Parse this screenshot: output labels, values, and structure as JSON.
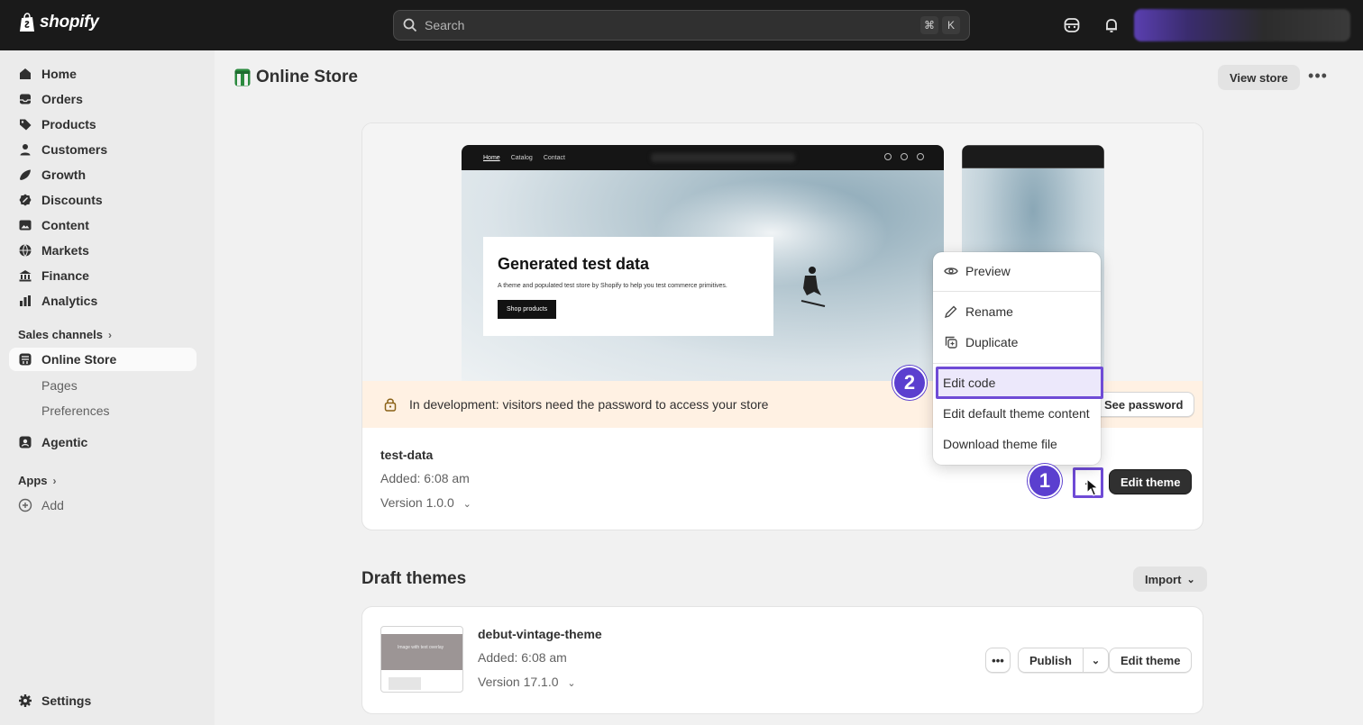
{
  "topbar": {
    "logo_text": "shopify",
    "search_placeholder": "Search",
    "shortcut_1": "⌘",
    "shortcut_2": "K"
  },
  "sidebar": {
    "items": [
      {
        "label": "Home",
        "icon": "home-icon"
      },
      {
        "label": "Orders",
        "icon": "inbox-icon"
      },
      {
        "label": "Products",
        "icon": "tag-icon"
      },
      {
        "label": "Customers",
        "icon": "person-icon"
      },
      {
        "label": "Growth",
        "icon": "growth-icon"
      },
      {
        "label": "Discounts",
        "icon": "discount-icon"
      },
      {
        "label": "Content",
        "icon": "image-icon"
      },
      {
        "label": "Markets",
        "icon": "globe-icon"
      },
      {
        "label": "Finance",
        "icon": "bank-icon"
      },
      {
        "label": "Analytics",
        "icon": "chart-icon"
      }
    ],
    "sales_channels_label": "Sales channels",
    "online_store_label": "Online Store",
    "sub_items": [
      "Pages",
      "Preferences"
    ],
    "agentic_label": "Agentic",
    "apps_label": "Apps",
    "add_label": "Add",
    "settings_label": "Settings"
  },
  "page": {
    "title": "Online Store",
    "view_store_label": "View store"
  },
  "current_theme": {
    "preview": {
      "nav_links": [
        "Home",
        "Catalog",
        "Contact"
      ],
      "hero_title": "Generated test data",
      "hero_text": "A theme and populated test store by Shopify to help you test commerce primitives.",
      "hero_button": "Shop products"
    },
    "banner_text": "In development: visitors need the password to access your store",
    "see_password_label": "See password",
    "name": "test-data",
    "added": "Added: 6:08 am",
    "version": "Version 1.0.0",
    "edit_theme_label": "Edit theme"
  },
  "menu": {
    "preview": "Preview",
    "rename": "Rename",
    "duplicate": "Duplicate",
    "edit_code": "Edit code",
    "edit_default_content": "Edit default theme content",
    "download": "Download theme file"
  },
  "badges": {
    "step1": "1",
    "step2": "2"
  },
  "draft": {
    "section_title": "Draft themes",
    "import_label": "Import",
    "thumb_text": "Image with text overlay",
    "name": "debut-vintage-theme",
    "added": "Added: 6:08 am",
    "version": "Version 17.1.0",
    "publish_label": "Publish",
    "edit_theme_label": "Edit theme"
  },
  "colors": {
    "accent": "#6f4bd6",
    "badge": "#5b3fcf",
    "banner": "#fff1e3",
    "topbar": "#1a1a1a"
  }
}
